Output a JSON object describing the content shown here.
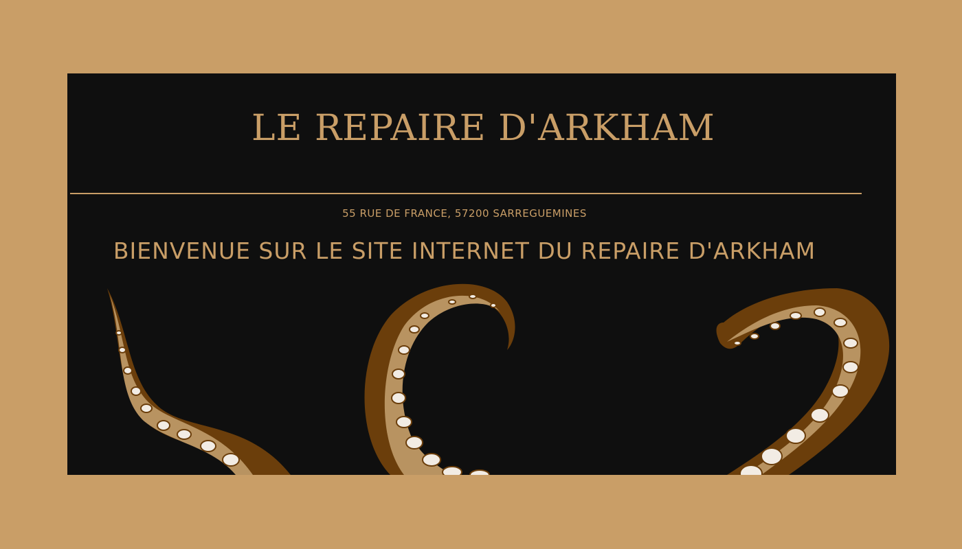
{
  "header": {
    "logo_text": "Le Repaire d'Arkham"
  },
  "address": "55 rue de France, 57200 Sarreguemines",
  "welcome": "Bienvenue sur le site internet du Repaire d'Arkham",
  "icons": {
    "decor": "tentacle-icon"
  },
  "colors": {
    "page_bg": "#c99e67",
    "panel_bg": "#0f0f0f",
    "accent": "#c99e67",
    "tentacle_dark": "#6b3e0b",
    "tentacle_mid": "#8a5a22",
    "tentacle_light": "#b89361",
    "sucker": "#f2ece4"
  }
}
